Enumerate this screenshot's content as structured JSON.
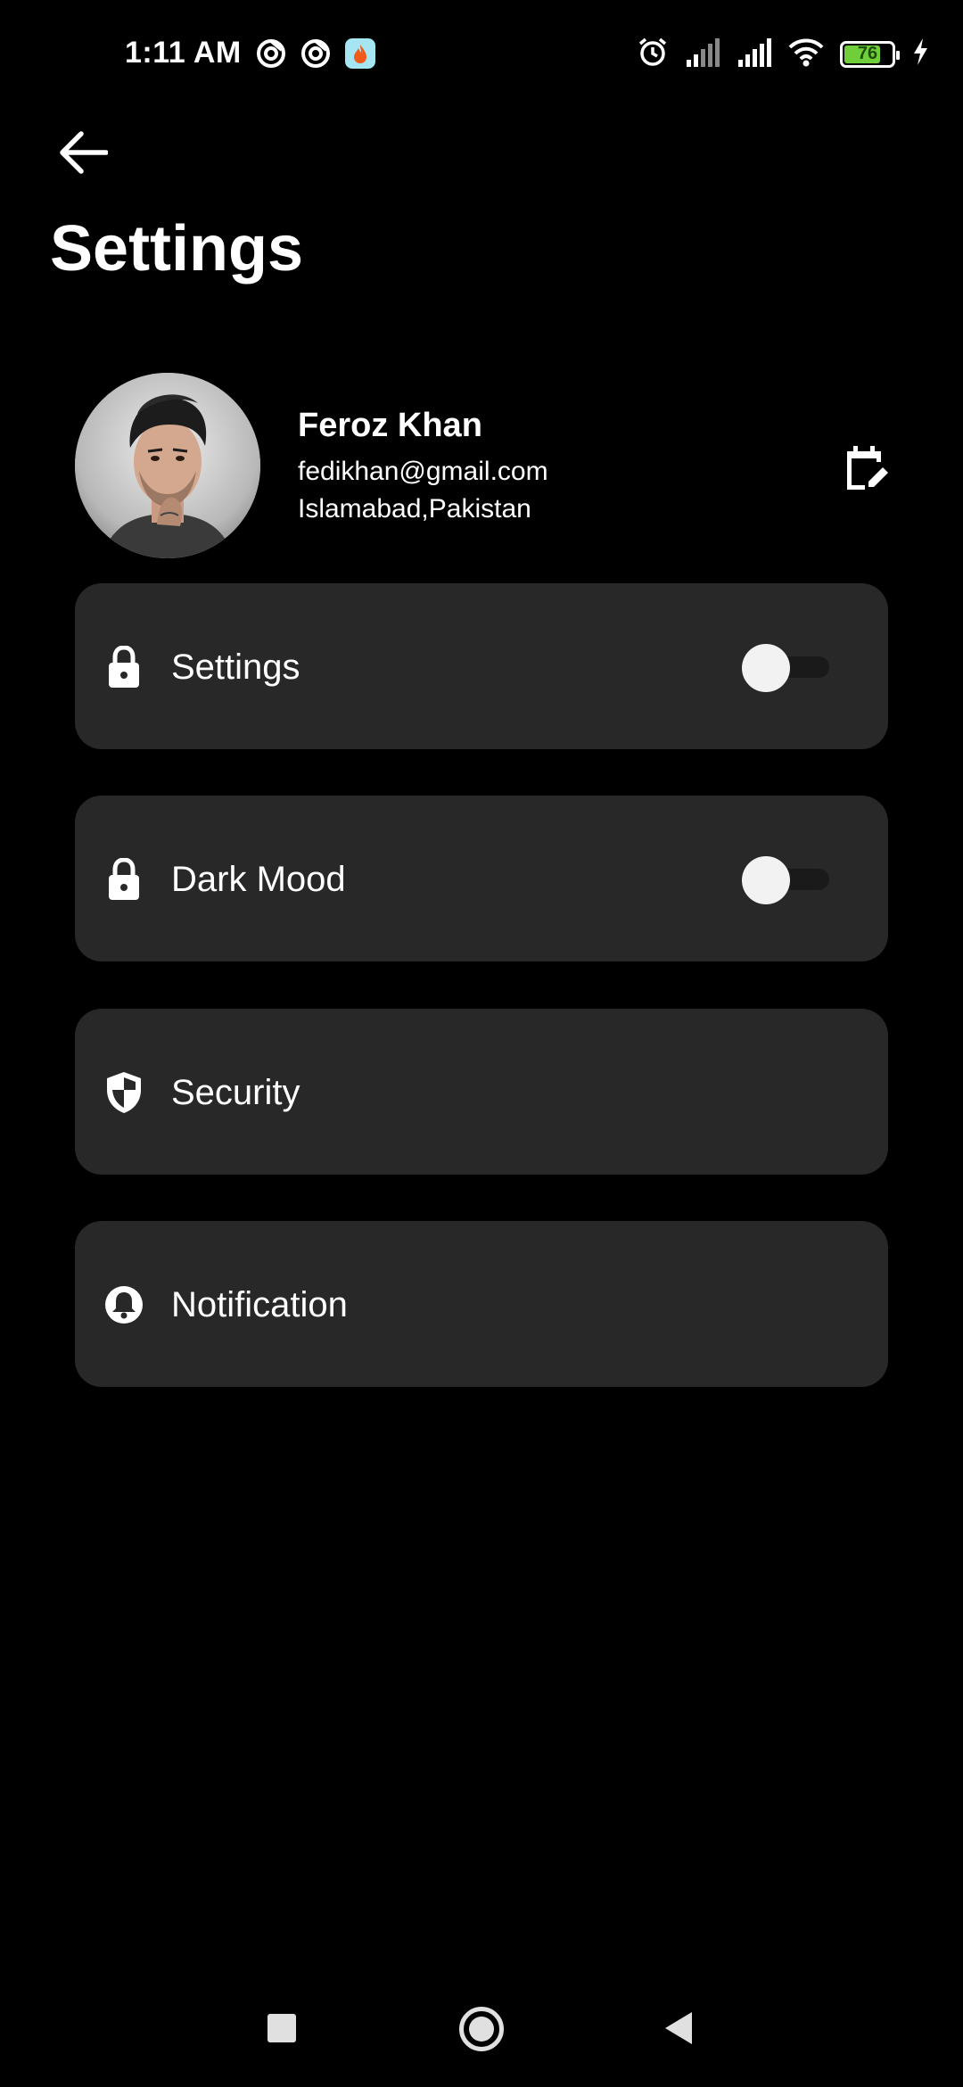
{
  "status_bar": {
    "time": "1:11 AM",
    "battery_level": "76",
    "battery_fraction": 0.76,
    "left_icons": [
      "sync-icon",
      "sync-icon",
      "app-notification-icon"
    ],
    "right_icons": [
      "alarm-icon",
      "signal-icon",
      "signal-icon",
      "wifi-icon",
      "battery-icon",
      "charging-icon"
    ]
  },
  "header": {
    "title": "Settings",
    "back_icon": "arrow-left-icon"
  },
  "profile": {
    "name": "Feroz Khan",
    "email": "fedikhan@gmail.com",
    "location": "Islamabad,Pakistan",
    "edit_icon": "calendar-edit-icon"
  },
  "menu": {
    "items": [
      {
        "label": "Settings",
        "icon": "lock-icon",
        "has_toggle": true,
        "toggle_on": false
      },
      {
        "label": "Dark Mood",
        "icon": "lock-icon",
        "has_toggle": true,
        "toggle_on": false
      },
      {
        "label": "Security",
        "icon": "shield-icon",
        "has_toggle": false
      },
      {
        "label": "Notification",
        "icon": "bell-icon",
        "has_toggle": false
      }
    ]
  },
  "nav_bar": {
    "icons": [
      "recent-apps-icon",
      "home-icon",
      "back-icon"
    ]
  },
  "colors": {
    "background": "#000000",
    "card": "#282828",
    "text": "#ffffff",
    "toggle_thumb": "#f2f2f2",
    "toggle_track": "#1a1a1a",
    "battery": "#6fce3a"
  }
}
